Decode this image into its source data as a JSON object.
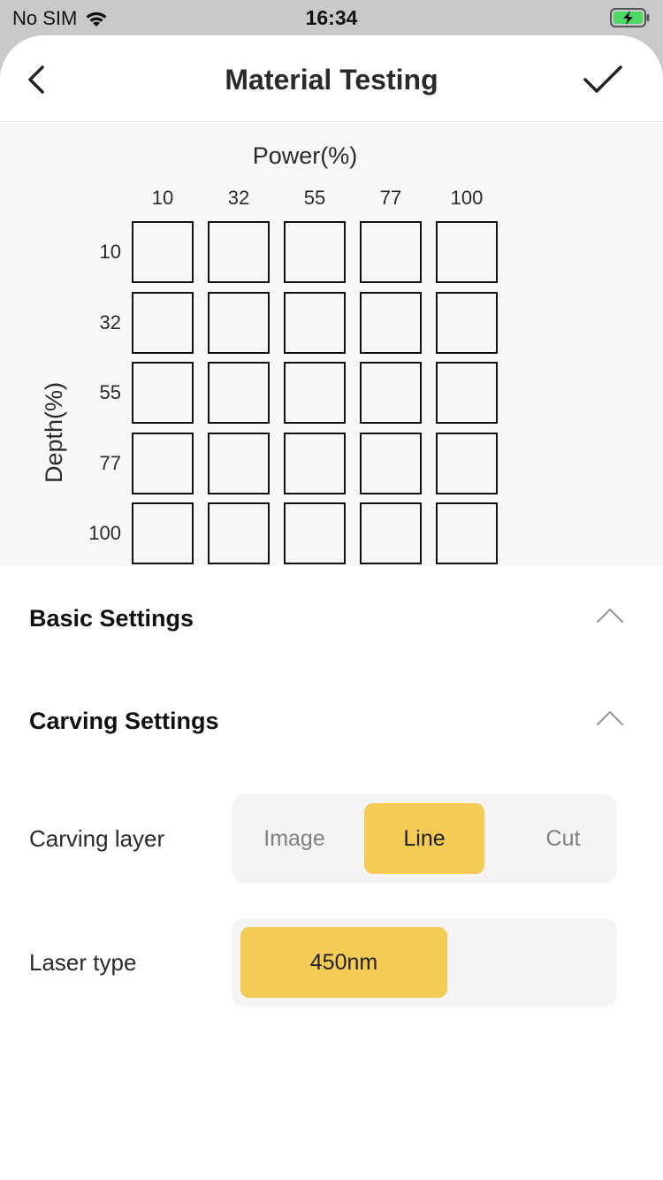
{
  "status_bar": {
    "carrier": "No SIM",
    "time": "16:34",
    "wifi_icon": "wifi-icon",
    "battery_icon": "battery-charging-icon",
    "battery_color": "#4cd964"
  },
  "nav": {
    "title": "Material Testing",
    "back_icon": "chevron-left-icon",
    "confirm_icon": "checkmark-icon"
  },
  "preview": {
    "x_axis_label": "Power(%)",
    "y_axis_label": "Depth(%)",
    "power_values": [
      "10",
      "32",
      "55",
      "77",
      "100"
    ],
    "depth_values": [
      "10",
      "32",
      "55",
      "77",
      "100"
    ]
  },
  "sections": {
    "basic": {
      "title": "Basic Settings",
      "icon": "chevron-up-icon"
    },
    "carving": {
      "title": "Carving Settings",
      "icon": "chevron-up-icon"
    }
  },
  "carving_layer": {
    "label": "Carving layer",
    "options": [
      "Image",
      "Line",
      "Cut"
    ],
    "selected": "Line"
  },
  "laser_type": {
    "label": "Laser type",
    "options": [
      "450nm"
    ],
    "selected": "450nm"
  },
  "colors": {
    "accent": "#f4cb55",
    "preview_bg": "#f7f7f7"
  }
}
